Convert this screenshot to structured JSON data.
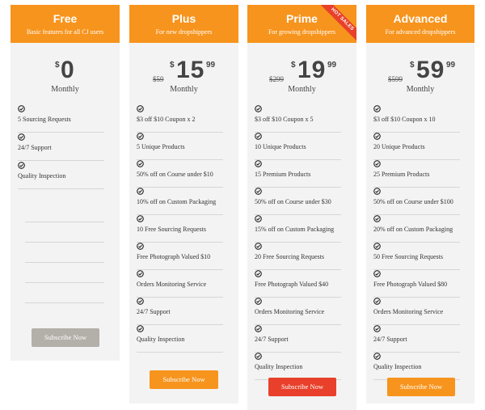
{
  "colors": {
    "header": "#f7941d",
    "button_orange": "#f7941d",
    "button_red": "#e8402a",
    "button_disabled": "#b3afa9",
    "card_bg": "#f3f3f3"
  },
  "plans": [
    {
      "name": "Free",
      "subtitle": "Basic features for all CJ users",
      "currency": "$",
      "amount": "0",
      "cents": "",
      "old_price": "",
      "period": "Monthly",
      "features": [
        "5 Sourcing Requests",
        "24/7 Support",
        "Quality Inspection"
      ],
      "button_label": "Subscribe Now",
      "button_state": "disabled"
    },
    {
      "name": "Plus",
      "subtitle": "For new dropshippers",
      "currency": "$",
      "amount": "15",
      "cents": "99",
      "old_price": "$59",
      "period": "Monthly",
      "features": [
        "$3 off $10 Coupon x 2",
        "5 Unique Products",
        "50% off on Course under $10",
        "10% off on Custom Packaging",
        "10 Free Sourcing Requests",
        "Free Photograph Valued $10",
        "Orders Monitoring Service",
        "24/7 Support",
        "Quality Inspection"
      ],
      "button_label": "Subscribe Now",
      "button_state": "orange"
    },
    {
      "name": "Prime",
      "subtitle": "For growing dropshippers",
      "badge": "HOT SALES",
      "currency": "$",
      "amount": "19",
      "cents": "99",
      "old_price": "$299",
      "period": "Monthly",
      "features": [
        "$3 off $10 Coupon x 5",
        "10 Unique Products",
        "15 Premium Products",
        "50% off on Course under $30",
        "15% off on Custom Packaging",
        "20 Free Sourcing Requests",
        "Free Photograph Valued $40",
        "Orders Monitoring Service",
        "24/7 Support",
        "Quality Inspection"
      ],
      "button_label": "Subscribe Now",
      "button_state": "red"
    },
    {
      "name": "Advanced",
      "subtitle": "For advanced dropshippers",
      "currency": "$",
      "amount": "59",
      "cents": "99",
      "old_price": "$599",
      "period": "Monthly",
      "features": [
        "$3 off $10 Coupon x 10",
        "20 Unique Products",
        "25 Premium Products",
        "50% off on Course under $100",
        "20% off on Custom Packaging",
        "50 Free Sourcing Requests",
        "Free Photograph Valued $80",
        "Orders Monitoring Service",
        "24/7 Support",
        "Quality Inspection"
      ],
      "button_label": "Subscribe Now",
      "button_state": "orange"
    }
  ]
}
